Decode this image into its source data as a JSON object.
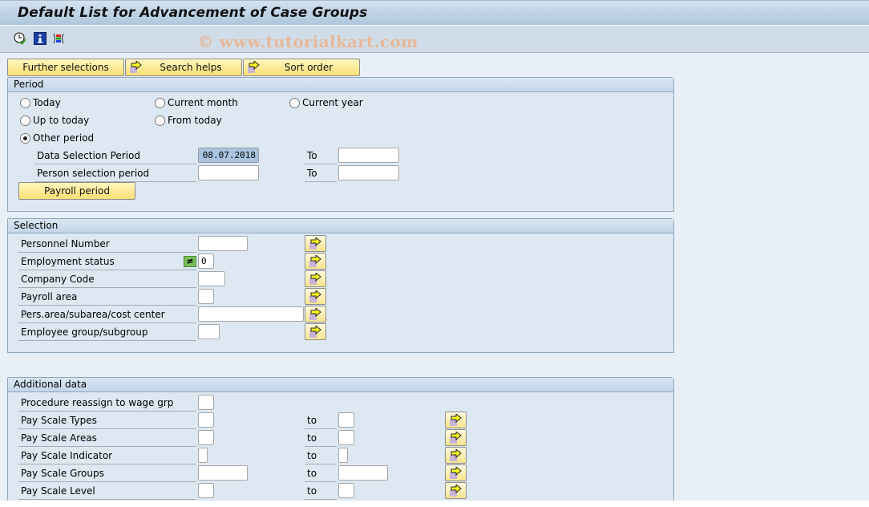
{
  "window": {
    "title": "Default List for Advancement of Case Groups"
  },
  "toolbar": {
    "icons": [
      {
        "name": "execute-clock-icon",
        "tooltip": ""
      },
      {
        "name": "info-icon",
        "tooltip": ""
      },
      {
        "name": "selection-options-icon",
        "tooltip": ""
      }
    ],
    "watermark": "© www.tutorialkart.com"
  },
  "top_buttons": {
    "further_selections": "Further selections",
    "search_helps": "Search helps",
    "sort_order": "Sort order"
  },
  "period": {
    "title": "Period",
    "radios": [
      {
        "label": "Today",
        "selected": false
      },
      {
        "label": "Current month",
        "selected": false
      },
      {
        "label": "Current year",
        "selected": false
      },
      {
        "label": "Up to today",
        "selected": false
      },
      {
        "label": "From today",
        "selected": false
      },
      {
        "label": "Other period",
        "selected": true
      }
    ],
    "data_selection_label": "Data Selection Period",
    "data_selection_from": "08.07.2018",
    "data_selection_to": "",
    "person_selection_label": "Person selection period",
    "person_selection_from": "",
    "person_selection_to": "",
    "to_label": "To",
    "payroll_period_button": "Payroll period"
  },
  "selection": {
    "title": "Selection",
    "rows": [
      {
        "label": "Personnel Number",
        "value": ""
      },
      {
        "label": "Employment status",
        "value": "0",
        "operator": "≠"
      },
      {
        "label": "Company Code",
        "value": ""
      },
      {
        "label": "Payroll area",
        "value": ""
      },
      {
        "label": "Pers.area/subarea/cost center",
        "value": ""
      },
      {
        "label": "Employee group/subgroup",
        "value": ""
      }
    ]
  },
  "additional": {
    "title": "Additional data",
    "to_label": "to",
    "rows": [
      {
        "label": "Procedure reassign to wage grp",
        "from": ""
      },
      {
        "label": "Pay Scale Types",
        "from": "",
        "to": ""
      },
      {
        "label": "Pay Scale Areas",
        "from": "",
        "to": ""
      },
      {
        "label": "Pay Scale Indicator",
        "from": "",
        "to": ""
      },
      {
        "label": "Pay Scale Groups",
        "from": "",
        "to": ""
      },
      {
        "label": "Pay Scale Level",
        "from": "",
        "to": ""
      }
    ]
  }
}
